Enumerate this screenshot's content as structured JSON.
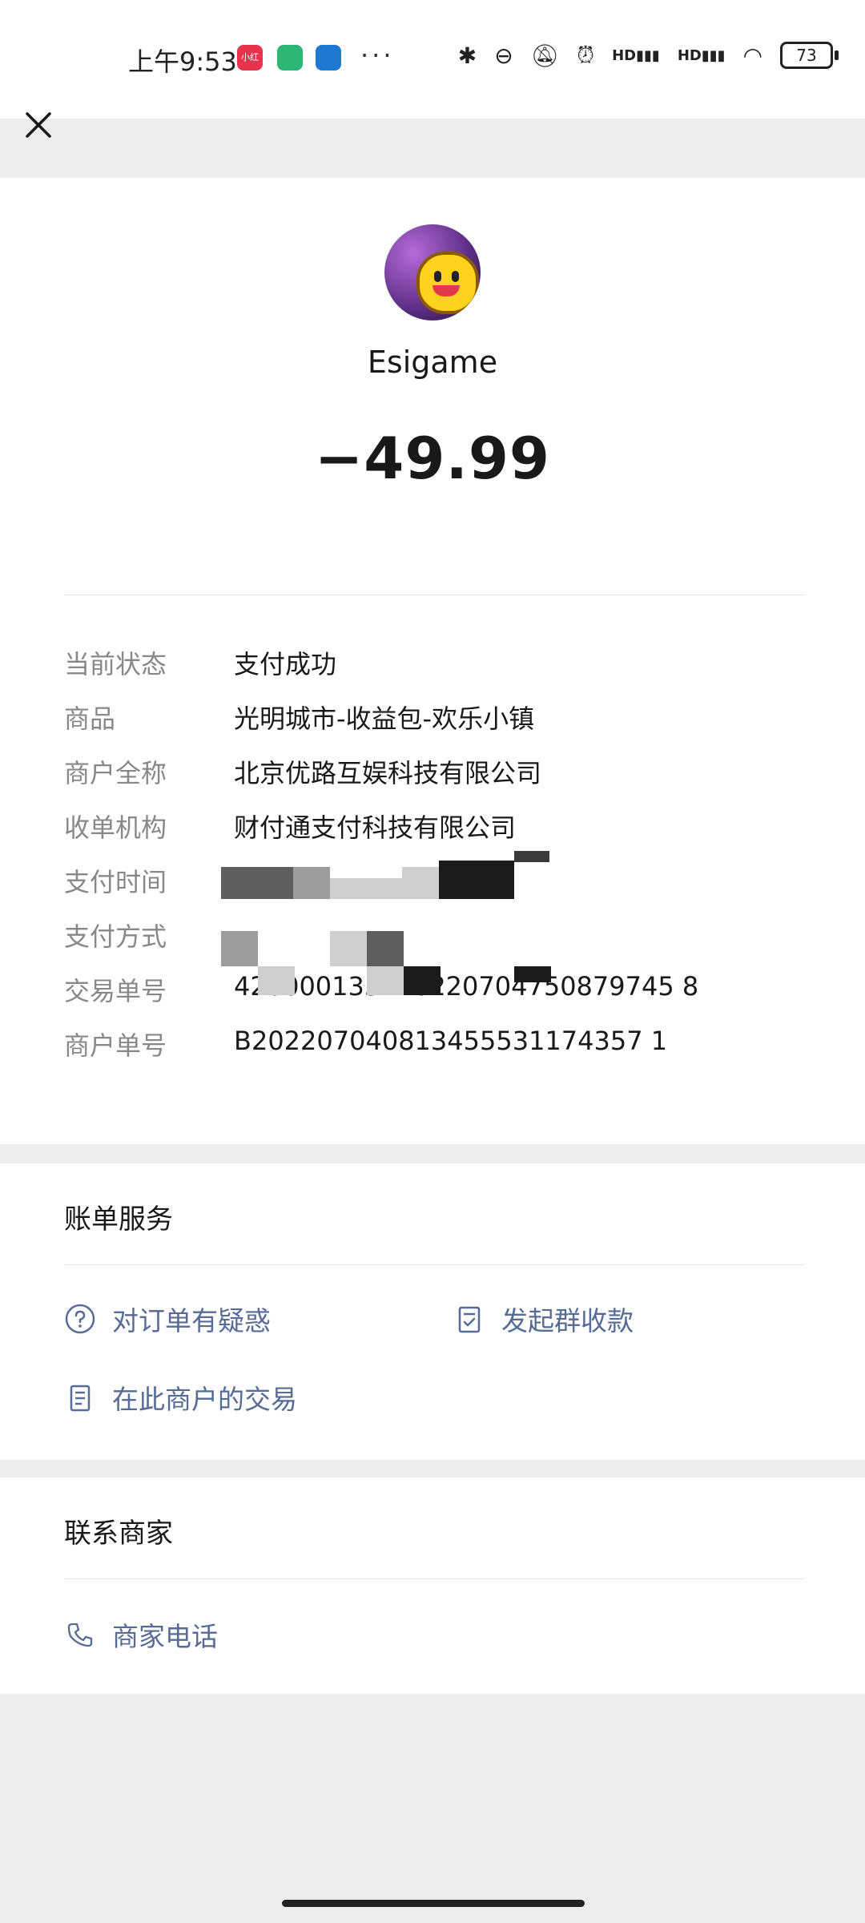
{
  "status_bar": {
    "time": "上午9:53",
    "app_chip_1": "小红书",
    "dots": "···",
    "battery": "73",
    "signal_1": "HD",
    "signal_2": "HD"
  },
  "header": {
    "close_icon": "close-icon"
  },
  "merchant": {
    "name": "Esigame",
    "amount": "−49.99"
  },
  "details": [
    {
      "label": "当前状态",
      "value": "支付成功"
    },
    {
      "label": "商品",
      "value": "光明城市-收益包-欢乐小镇"
    },
    {
      "label": "商户全称",
      "value": "北京优路互娱科技有限公司"
    },
    {
      "label": "收单机构",
      "value": "财付通支付科技有限公司"
    },
    {
      "label": "支付时间",
      "value": ""
    },
    {
      "label": "支付方式",
      "value": ""
    },
    {
      "label": "交易单号",
      "value": "420000135420220704750879745 8"
    },
    {
      "label": "商户单号",
      "value": "B202207040813455531174357 1"
    }
  ],
  "bill_service": {
    "title": "账单服务",
    "actions": [
      {
        "label": "对订单有疑惑",
        "icon": "question-circle-icon"
      },
      {
        "label": "发起群收款",
        "icon": "checklist-icon"
      },
      {
        "label": "在此商户的交易",
        "icon": "document-icon"
      }
    ]
  },
  "contact": {
    "title": "联系商家",
    "actions": [
      {
        "label": "商家电话",
        "icon": "phone-icon"
      }
    ]
  },
  "colors": {
    "link": "#576b95",
    "label": "#888888",
    "background": "#ededed"
  }
}
